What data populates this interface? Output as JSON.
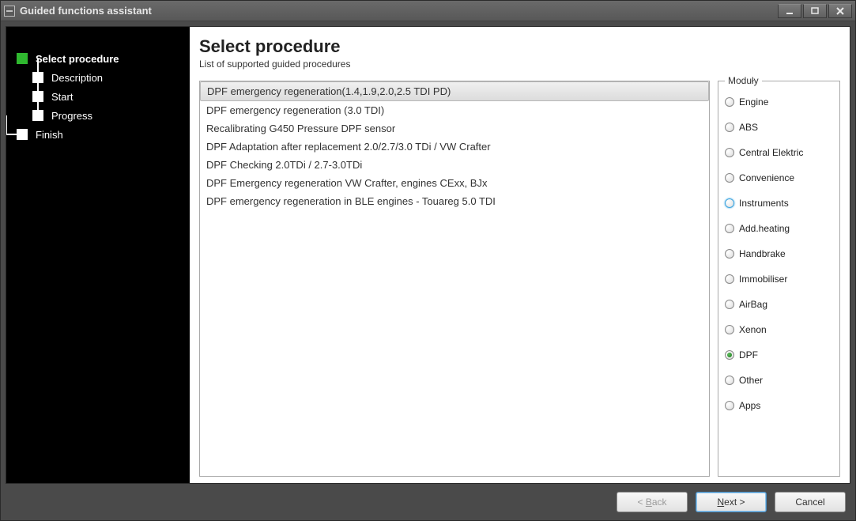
{
  "window": {
    "title": "Guided functions assistant"
  },
  "wizard": {
    "steps": [
      {
        "label": "Select procedure",
        "active": true,
        "indent": 0
      },
      {
        "label": "Description",
        "active": false,
        "indent": 1
      },
      {
        "label": "Start",
        "active": false,
        "indent": 1
      },
      {
        "label": "Progress",
        "active": false,
        "indent": 1
      },
      {
        "label": "Finish",
        "active": false,
        "indent": 0
      }
    ]
  },
  "header": {
    "title": "Select procedure",
    "subtitle": "List of supported guided procedures"
  },
  "procedures": {
    "selected_index": 0,
    "items": [
      "DPF emergency regeneration(1.4,1.9,2.0,2.5 TDI PD)",
      "DPF emergency regeneration (3.0 TDI)",
      "Recalibrating G450 Pressure DPF sensor",
      "DPF Adaptation after replacement 2.0/2.7/3.0 TDi / VW Crafter",
      "DPF Checking 2.0TDi / 2.7-3.0TDi",
      "DPF Emergency regeneration VW Crafter, engines CExx, BJx",
      "DPF emergency regeneration in BLE engines - Touareg 5.0 TDI"
    ]
  },
  "modules": {
    "legend": "Moduły",
    "selected": "DPF",
    "hover": "Instruments",
    "items": [
      "Engine",
      "ABS",
      "Central Elektric",
      "Convenience",
      "Instruments",
      "Add.heating",
      "Handbrake",
      "Immobiliser",
      "AirBag",
      "Xenon",
      "DPF",
      "Other",
      "Apps"
    ]
  },
  "buttons": {
    "back": "< Back",
    "next": "Next >",
    "cancel": "Cancel"
  }
}
